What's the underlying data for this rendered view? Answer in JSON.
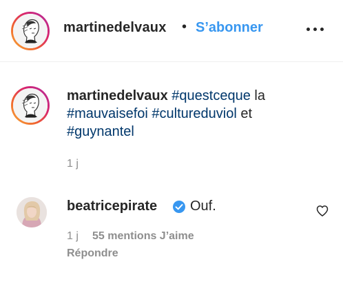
{
  "header": {
    "username": "martinedelvaux",
    "separator": "•",
    "follow_label": "S’abonner",
    "more_icon": "more-options-icon"
  },
  "caption": {
    "username": "martinedelvaux",
    "parts": [
      {
        "type": "hashtag",
        "text": "#questceque"
      },
      {
        "type": "text",
        "text": " la "
      },
      {
        "type": "hashtag",
        "text": "#mauvaisefoi"
      },
      {
        "type": "text",
        "text": " "
      },
      {
        "type": "hashtag",
        "text": "#cultureduviol"
      },
      {
        "type": "text",
        "text": " et "
      },
      {
        "type": "hashtag",
        "text": "#guynantel"
      }
    ],
    "time": "1 j"
  },
  "reply": {
    "username": "beatricepirate",
    "verified": true,
    "text": "Ouf.",
    "time": "1 j",
    "likes": "55 mentions J’aime",
    "reply_label": "Répondre"
  },
  "colors": {
    "link": "#00376b",
    "follow": "#3897f0",
    "verified": "#3897f0",
    "secondary": "#8e8e8e"
  }
}
